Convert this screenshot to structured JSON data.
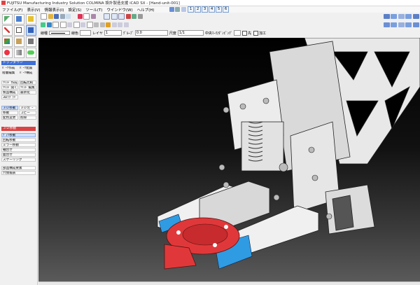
{
  "window": {
    "title": "FUJITSU Manufacturing Industry Solution COLMINA 設計製造支援 iCAD SX - [Hand-unit-001]"
  },
  "menu": {
    "items": [
      "ファイル(F)",
      "表示(V)",
      "情報表示(I)",
      "設定(S)",
      "ツール(T)",
      "ウインドウ(W)",
      "ヘルプ(H)"
    ],
    "numbers": [
      "1",
      "2",
      "3",
      "4",
      "5",
      "6"
    ]
  },
  "props": {
    "line_type_label": "線種",
    "color_label": "線色",
    "layer_label": "レイヤ",
    "layer_value": "1",
    "group_label": "ｸﾞﾙｰﾌﾟ",
    "group_value": "0.0",
    "scale_label": "尺度",
    "scale_value": "1/1",
    "centerline_label": "中央ﾏｰｸ/ﾀﾞﾝﾋﾟﾝｸﾞ",
    "check1_label": "先",
    "check2_label": "加工"
  },
  "panel": {
    "top_section": "トップダウン",
    "top_buttons": [
      [
        "ﾊﾟｰﾂ作成",
        "ﾊﾟｰﾂ配置"
      ],
      [
        "階層編集",
        "ﾊﾟｰﾂ構成"
      ]
    ],
    "mid_buttons": [
      [
        "ｿﾘｯﾄﾞ作成",
        "回転比較"
      ],
      [
        "ｿﾘｯﾄﾞ開く",
        "ｿﾘｯﾄﾞ編集"
      ],
      [
        "製品構成",
        "最新化"
      ],
      [
        "3Dﾗﾌﾞﾗﾘ",
        ""
      ]
    ],
    "view_buttons": [
      [
        "３Ｄ移動",
        "３Ｄｺﾋﾟｰ"
      ],
      [
        "移動",
        "コピー"
      ],
      [
        "配色変更",
        "削除"
      ]
    ],
    "move_section": "３Ｄ移動",
    "move_items": [
      "ﾃﾞｨﾘ移動",
      "回転移動",
      "ミラー移動",
      "軸合せ",
      "面合せ",
      "スケーリング"
    ],
    "bottom_items": [
      "部品構成要素",
      "穴情報表"
    ]
  },
  "colors": {
    "section_blue": "#3f6fd4",
    "section_red": "#d94343",
    "part_red": "#e0383a",
    "part_blue": "#2f9be3"
  }
}
